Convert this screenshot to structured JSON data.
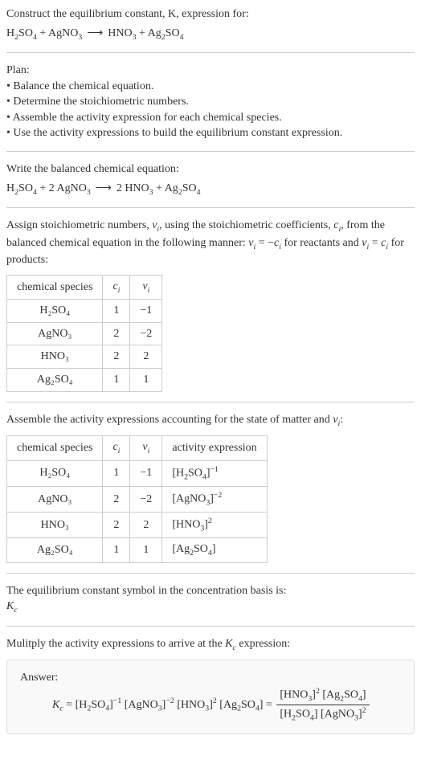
{
  "intro": {
    "line1": "Construct the equilibrium constant, K, expression for:",
    "eq1_r1": "H",
    "eq1_r1s": "2",
    "eq1_r1b": "SO",
    "eq1_r1bs": "4",
    "plus": " + ",
    "eq1_r2": "AgNO",
    "eq1_r2s": "3",
    "arrow": "⟶",
    "eq1_p1": "HNO",
    "eq1_p1s": "3",
    "eq1_p2": "Ag",
    "eq1_p2s": "2",
    "eq1_p2b": "SO",
    "eq1_p2bs": "4"
  },
  "plan": {
    "title": "Plan:",
    "b1": "• Balance the chemical equation.",
    "b2": "• Determine the stoichiometric numbers.",
    "b3": "• Assemble the activity expression for each chemical species.",
    "b4": "• Use the activity expressions to build the equilibrium constant expression."
  },
  "balanced": {
    "line": "Write the balanced chemical equation:",
    "c2": "2 ",
    "c2b": "2 "
  },
  "stoich": {
    "text1": "Assign stoichiometric numbers, ",
    "nu": "ν",
    "i": "i",
    "text2": ", using the stoichiometric coefficients, ",
    "c": "c",
    "text3": ", from the balanced chemical equation in the following manner: ",
    "eq1a": " = −",
    "text4": " for reactants and ",
    "eq2a": " = ",
    "text5": " for products:"
  },
  "table1": {
    "h1": "chemical species",
    "h2": "c",
    "h3": "ν",
    "r1": {
      "s": "H₂SO₄",
      "c": "1",
      "n": "−1"
    },
    "r2": {
      "s": "AgNO₃",
      "c": "2",
      "n": "−2"
    },
    "r3": {
      "s": "HNO₃",
      "c": "2",
      "n": "2"
    },
    "r4": {
      "s": "Ag₂SO₄",
      "c": "1",
      "n": "1"
    }
  },
  "activity": {
    "line": "Assemble the activity expressions accounting for the state of matter and ",
    "colon": ":"
  },
  "table2": {
    "h1": "chemical species",
    "h2": "c",
    "h3": "ν",
    "h4": "activity expression",
    "r1": {
      "s": "H₂SO₄",
      "c": "1",
      "n": "−1",
      "a1": "[H",
      "a2": "2",
      "a3": "SO",
      "a4": "4",
      "a5": "]",
      "e": "−1"
    },
    "r2": {
      "s": "AgNO₃",
      "c": "2",
      "n": "−2",
      "a1": "[AgNO",
      "a2": "3",
      "a3": "]",
      "e": "−2"
    },
    "r3": {
      "s": "HNO₃",
      "c": "2",
      "n": "2",
      "a1": "[HNO",
      "a2": "3",
      "a3": "]",
      "e": "2"
    },
    "r4": {
      "s": "Ag₂SO₄",
      "c": "1",
      "n": "1",
      "a1": "[Ag",
      "a2": "2",
      "a3": "SO",
      "a4": "4",
      "a5": "]"
    }
  },
  "kc": {
    "line": "The equilibrium constant symbol in the concentration basis is:",
    "sym": "K",
    "sub": "c"
  },
  "mult": {
    "line": "Mulitply the activity expressions to arrive at the ",
    "line2": " expression:"
  },
  "answer": {
    "label": "Answer:",
    "eq": " = ",
    "lb": "[",
    "rb": "]",
    "H2SO4": {
      "p1": "H",
      "s1": "2",
      "p2": "SO",
      "s2": "4"
    },
    "AgNO3": {
      "p1": "AgNO",
      "s1": "3"
    },
    "HNO3": {
      "p1": "HNO",
      "s1": "3"
    },
    "Ag2SO4": {
      "p1": "Ag",
      "s1": "2",
      "p2": "SO",
      "s2": "4"
    },
    "em1": "−1",
    "em2": "−2",
    "e2": "2",
    "sp": " "
  }
}
